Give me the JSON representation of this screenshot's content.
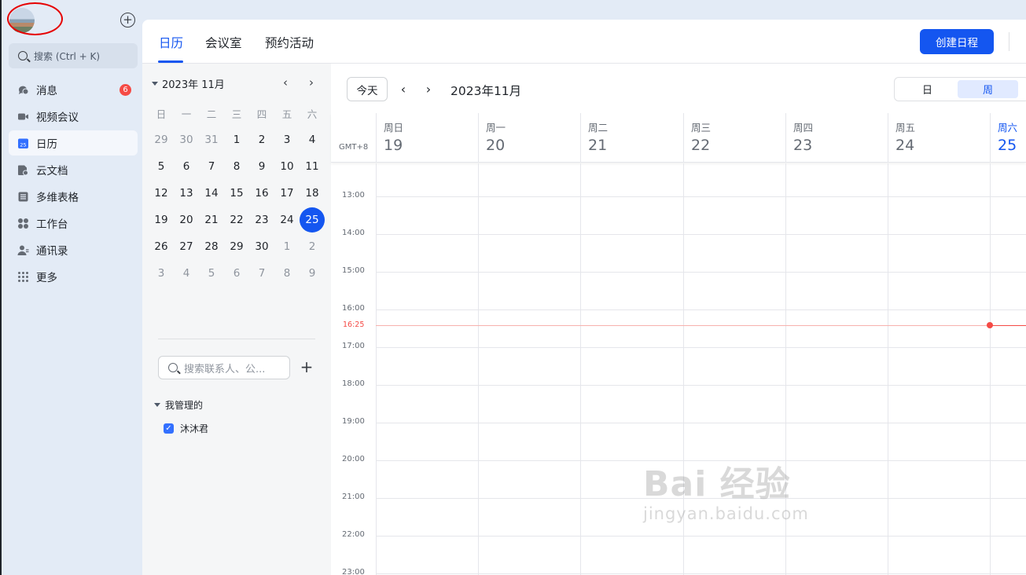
{
  "sidebar": {
    "search_placeholder": "搜索 (Ctrl + K)",
    "items": [
      {
        "label": "消息",
        "icon": "chat-bubble-icon",
        "badge": "6"
      },
      {
        "label": "视频会议",
        "icon": "video-camera-icon"
      },
      {
        "label": "日历",
        "icon": "calendar-icon",
        "active": true,
        "icon_text": "25"
      },
      {
        "label": "云文档",
        "icon": "cloud-doc-icon"
      },
      {
        "label": "多维表格",
        "icon": "base-table-icon"
      },
      {
        "label": "工作台",
        "icon": "workplace-grid-icon"
      },
      {
        "label": "通讯录",
        "icon": "contacts-icon"
      },
      {
        "label": "更多",
        "icon": "more-dots-icon"
      }
    ]
  },
  "tabs": [
    {
      "label": "日历",
      "active": true
    },
    {
      "label": "会议室"
    },
    {
      "label": "预约活动"
    }
  ],
  "create_button": "创建日程",
  "mini_calendar": {
    "title": "2023年 11月",
    "weekdays": [
      "日",
      "一",
      "二",
      "三",
      "四",
      "五",
      "六"
    ],
    "weeks": [
      [
        "29",
        "30",
        "31",
        "1",
        "2",
        "3",
        "4"
      ],
      [
        "5",
        "6",
        "7",
        "8",
        "9",
        "10",
        "11"
      ],
      [
        "12",
        "13",
        "14",
        "15",
        "16",
        "17",
        "18"
      ],
      [
        "19",
        "20",
        "21",
        "22",
        "23",
        "24",
        "25"
      ],
      [
        "26",
        "27",
        "28",
        "29",
        "30",
        "1",
        "2"
      ],
      [
        "3",
        "4",
        "5",
        "6",
        "7",
        "8",
        "9"
      ]
    ],
    "today": "25"
  },
  "contact_search_placeholder": "搜索联系人、公...",
  "managed_section": {
    "title": "我管理的",
    "calendars": [
      {
        "name": "沐沐君",
        "checked": true
      }
    ]
  },
  "toolbar": {
    "today_label": "今天",
    "period": "2023年11月",
    "view_day": "日",
    "view_week": "周",
    "active_view": "周"
  },
  "timezone": "GMT+8",
  "week_days": [
    {
      "name": "周日",
      "num": "19"
    },
    {
      "name": "周一",
      "num": "20"
    },
    {
      "name": "周二",
      "num": "21"
    },
    {
      "name": "周三",
      "num": "22"
    },
    {
      "name": "周四",
      "num": "23"
    },
    {
      "name": "周五",
      "num": "24"
    },
    {
      "name": "周六",
      "num": "25",
      "today": true
    }
  ],
  "hours": [
    "13:00",
    "14:00",
    "15:00",
    "16:00",
    "17:00",
    "18:00",
    "19:00",
    "20:00",
    "21:00",
    "22:00",
    "23:00"
  ],
  "current_time": "16:25",
  "watermark": {
    "main": "Bai 经验",
    "sub": "jingyan.baidu.com"
  },
  "colors": {
    "accent": "#1456f0",
    "now": "#f54a45",
    "badge": "#f54a45",
    "sidebar_bg": "#e3ebf6"
  }
}
